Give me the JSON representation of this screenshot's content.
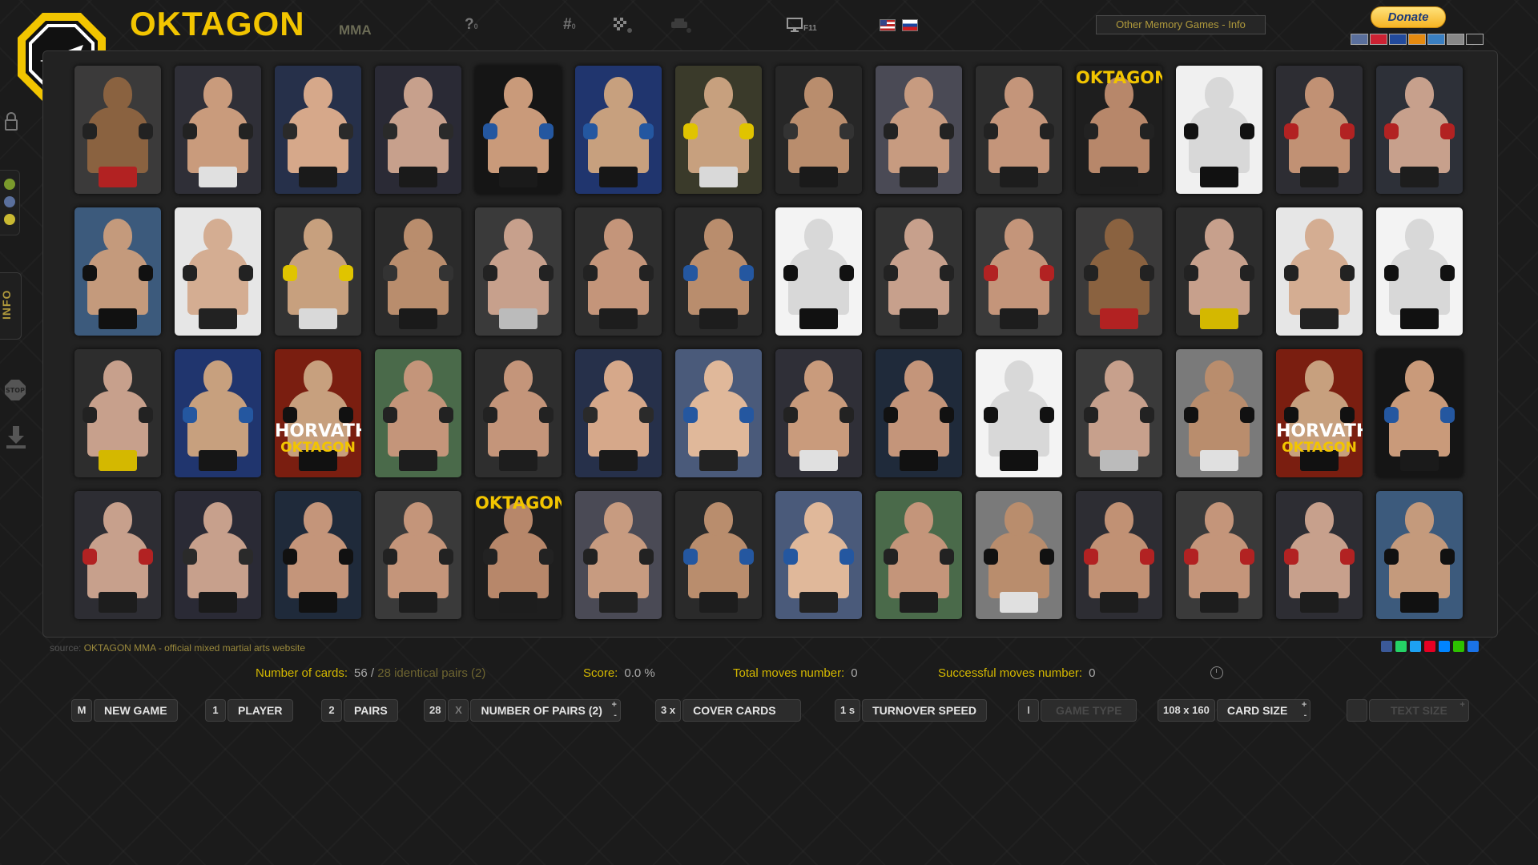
{
  "header": {
    "brand": "OKTAGON",
    "brand_sub": "MMA",
    "help": "?",
    "help_sub": "0",
    "hash": "#",
    "hash_sub": "0",
    "fullscreen_sub": "F11",
    "info_link": "Other Memory Games - Info",
    "donate": "Donate"
  },
  "sidebar": {
    "info": "INFO",
    "colors": [
      "#7a9a2c",
      "#5a6f9c",
      "#c9b932"
    ]
  },
  "cards": [
    {
      "bg": "#3b3a3a",
      "skin": "#8a6240",
      "shorts": "#b22222",
      "glove": "#222"
    },
    {
      "bg": "#2f2f37",
      "skin": "#c99b7c",
      "shorts": "#e0e0e0",
      "glove": "#222"
    },
    {
      "bg": "#26304a",
      "skin": "#d6a88a",
      "shorts": "#1a1a1a",
      "glove": "#2a2a2a"
    },
    {
      "bg": "#2a2a35",
      "skin": "#c7a08c",
      "shorts": "#1a1a1a",
      "glove": "#2a2a2a"
    },
    {
      "bg": "#151515",
      "skin": "#c99a7a",
      "shorts": "#1a1a1a",
      "glove": "#2457a0"
    },
    {
      "bg": "#20356e",
      "skin": "#c7a07e",
      "shorts": "#161616",
      "glove": "#2457a0"
    },
    {
      "bg": "#3a3a2a",
      "skin": "#c7a07e",
      "shorts": "#d9d9d9",
      "glove": "#e0c400"
    },
    {
      "bg": "#272727",
      "skin": "#b98d6d",
      "shorts": "#1a1a1a",
      "glove": "#333"
    },
    {
      "bg": "#4a4a55",
      "skin": "#c79b80",
      "shorts": "#222",
      "glove": "#222"
    },
    {
      "bg": "#2e2e2e",
      "skin": "#c4957a",
      "shorts": "#1d1d1d",
      "glove": "#222"
    },
    {
      "bg": "#1e1e1e",
      "skin": "#b7876a",
      "shorts": "#1d1d1d",
      "glove": "#222",
      "text": "OKTAGON"
    },
    {
      "bg": "#f0f0f0",
      "skin": "#d8d8d8",
      "shorts": "#111",
      "glove": "#111"
    },
    {
      "bg": "#2d2d33",
      "skin": "#c19174",
      "shorts": "#1d1d1d",
      "glove": "#b22222"
    },
    {
      "bg": "#2d3038",
      "skin": "#c7a08c",
      "shorts": "#1d1d1d",
      "glove": "#b22222"
    },
    {
      "bg": "#3c5a7c",
      "skin": "#c49a7c",
      "shorts": "#111",
      "glove": "#111"
    },
    {
      "bg": "#e6e6e6",
      "skin": "#d4ad92",
      "shorts": "#222",
      "glove": "#222"
    },
    {
      "bg": "#333",
      "skin": "#c7a07e",
      "shorts": "#d9d9d9",
      "glove": "#e0c400"
    },
    {
      "bg": "#2b2b2b",
      "skin": "#b98d6d",
      "shorts": "#1a1a1a",
      "glove": "#333"
    },
    {
      "bg": "#3a3a3a",
      "skin": "#c7a08c",
      "shorts": "#bbb",
      "glove": "#222"
    },
    {
      "bg": "#2e2e2e",
      "skin": "#c4957a",
      "shorts": "#1d1d1d",
      "glove": "#222"
    },
    {
      "bg": "#2a2a2a",
      "skin": "#b98d6d",
      "shorts": "#1d1d1d",
      "glove": "#2457a0"
    },
    {
      "bg": "#f3f3f3",
      "skin": "#d8d8d8",
      "shorts": "#111",
      "glove": "#111"
    },
    {
      "bg": "#333333",
      "skin": "#c7a08c",
      "shorts": "#1d1d1d",
      "glove": "#222"
    },
    {
      "bg": "#3a3a3a",
      "skin": "#c4957a",
      "shorts": "#1d1d1d",
      "glove": "#b22222"
    },
    {
      "bg": "#3b3a3a",
      "skin": "#8a6240",
      "shorts": "#b22222",
      "glove": "#222"
    },
    {
      "bg": "#2d2d2d",
      "skin": "#c7a08c",
      "shorts": "#d4b800",
      "glove": "#222"
    },
    {
      "bg": "#e6e6e6",
      "skin": "#d4ad92",
      "shorts": "#222",
      "glove": "#222"
    },
    {
      "bg": "#f3f3f3",
      "skin": "#d8d8d8",
      "shorts": "#111",
      "glove": "#111"
    },
    {
      "bg": "#2d2d2d",
      "skin": "#c7a08c",
      "shorts": "#d4b800",
      "glove": "#222"
    },
    {
      "bg": "#20356e",
      "skin": "#c7a07e",
      "shorts": "#161616",
      "glove": "#2457a0"
    },
    {
      "bg": "#7a1e10",
      "skin": "#c7a07e",
      "shorts": "#111",
      "glove": "#111",
      "text": "HORVATH",
      "text2": "OKTAGON"
    },
    {
      "bg": "#4a6a4a",
      "skin": "#c4957a",
      "shorts": "#1d1d1d",
      "glove": "#222"
    },
    {
      "bg": "#2e2e2e",
      "skin": "#c4957a",
      "shorts": "#1d1d1d",
      "glove": "#222"
    },
    {
      "bg": "#26304a",
      "skin": "#d6a88a",
      "shorts": "#1a1a1a",
      "glove": "#2a2a2a"
    },
    {
      "bg": "#4a5a7a",
      "skin": "#e0b89a",
      "shorts": "#222",
      "glove": "#2457a0"
    },
    {
      "bg": "#2f2f37",
      "skin": "#c99b7c",
      "shorts": "#e0e0e0",
      "glove": "#222"
    },
    {
      "bg": "#1f2a3a",
      "skin": "#c4957a",
      "shorts": "#111",
      "glove": "#111"
    },
    {
      "bg": "#f3f3f3",
      "skin": "#d8d8d8",
      "shorts": "#111",
      "glove": "#111"
    },
    {
      "bg": "#3a3a3a",
      "skin": "#c7a08c",
      "shorts": "#bbb",
      "glove": "#222"
    },
    {
      "bg": "#7a7a7a",
      "skin": "#b98d6d",
      "shorts": "#e0e0e0",
      "glove": "#111"
    },
    {
      "bg": "#7a1e10",
      "skin": "#c7a07e",
      "shorts": "#111",
      "glove": "#111",
      "text": "HORVATH",
      "text2": "OKTAGON"
    },
    {
      "bg": "#151515",
      "skin": "#c99a7a",
      "shorts": "#1a1a1a",
      "glove": "#2457a0"
    },
    {
      "bg": "#2d2d33",
      "skin": "#c7a08c",
      "shorts": "#1d1d1d",
      "glove": "#b22222"
    },
    {
      "bg": "#2a2a35",
      "skin": "#c7a08c",
      "shorts": "#1a1a1a",
      "glove": "#2a2a2a"
    },
    {
      "bg": "#1f2a3a",
      "skin": "#c4957a",
      "shorts": "#111",
      "glove": "#111"
    },
    {
      "bg": "#3a3a3a",
      "skin": "#c4957a",
      "shorts": "#1d1d1d",
      "glove": "#222"
    },
    {
      "bg": "#1e1e1e",
      "skin": "#b7876a",
      "shorts": "#1d1d1d",
      "glove": "#222",
      "text": "OKTAGON"
    },
    {
      "bg": "#4a4a55",
      "skin": "#c79b80",
      "shorts": "#222",
      "glove": "#222"
    },
    {
      "bg": "#2a2a2a",
      "skin": "#b98d6d",
      "shorts": "#1d1d1d",
      "glove": "#2457a0"
    },
    {
      "bg": "#4a5a7a",
      "skin": "#e0b89a",
      "shorts": "#222",
      "glove": "#2457a0"
    },
    {
      "bg": "#4a6a4a",
      "skin": "#c4957a",
      "shorts": "#1d1d1d",
      "glove": "#222"
    },
    {
      "bg": "#7a7a7a",
      "skin": "#b98d6d",
      "shorts": "#e0e0e0",
      "glove": "#111"
    },
    {
      "bg": "#2d2d33",
      "skin": "#c19174",
      "shorts": "#1d1d1d",
      "glove": "#b22222"
    },
    {
      "bg": "#3a3a3a",
      "skin": "#c4957a",
      "shorts": "#1d1d1d",
      "glove": "#b22222"
    },
    {
      "bg": "#2d2d33",
      "skin": "#c7a08c",
      "shorts": "#1d1d1d",
      "glove": "#b22222"
    },
    {
      "bg": "#3c5a7c",
      "skin": "#c49a7c",
      "shorts": "#111",
      "glove": "#111"
    }
  ],
  "footer": {
    "source_prefix": "source:",
    "source_text": "OKTAGON MMA - official mixed martial arts website",
    "cards_label": "Number of cards:",
    "cards_value": "56 /",
    "cards_dim": "28  identical pairs (2)",
    "score_label": "Score:",
    "score_value": "0.0 %",
    "total_label": "Total moves number:",
    "total_value": "0",
    "success_label": "Successful moves number:",
    "success_value": "0"
  },
  "controls": {
    "new_game_key": "M",
    "new_game": "NEW GAME",
    "player_key": "1",
    "player": "PLAYER",
    "pairs_key": "2",
    "pairs": "PAIRS",
    "num_pairs_key": "28",
    "num_pairs_x": "X",
    "num_pairs": "NUMBER OF PAIRS (2)",
    "cover_key": "3 x",
    "cover": "COVER CARDS",
    "speed_key": "1 s",
    "speed": "TURNOVER SPEED",
    "game_type_key": "I",
    "game_type": "GAME TYPE",
    "card_size_key": "108 x 160",
    "card_size": "CARD SIZE",
    "text_size": "TEXT SIZE"
  }
}
